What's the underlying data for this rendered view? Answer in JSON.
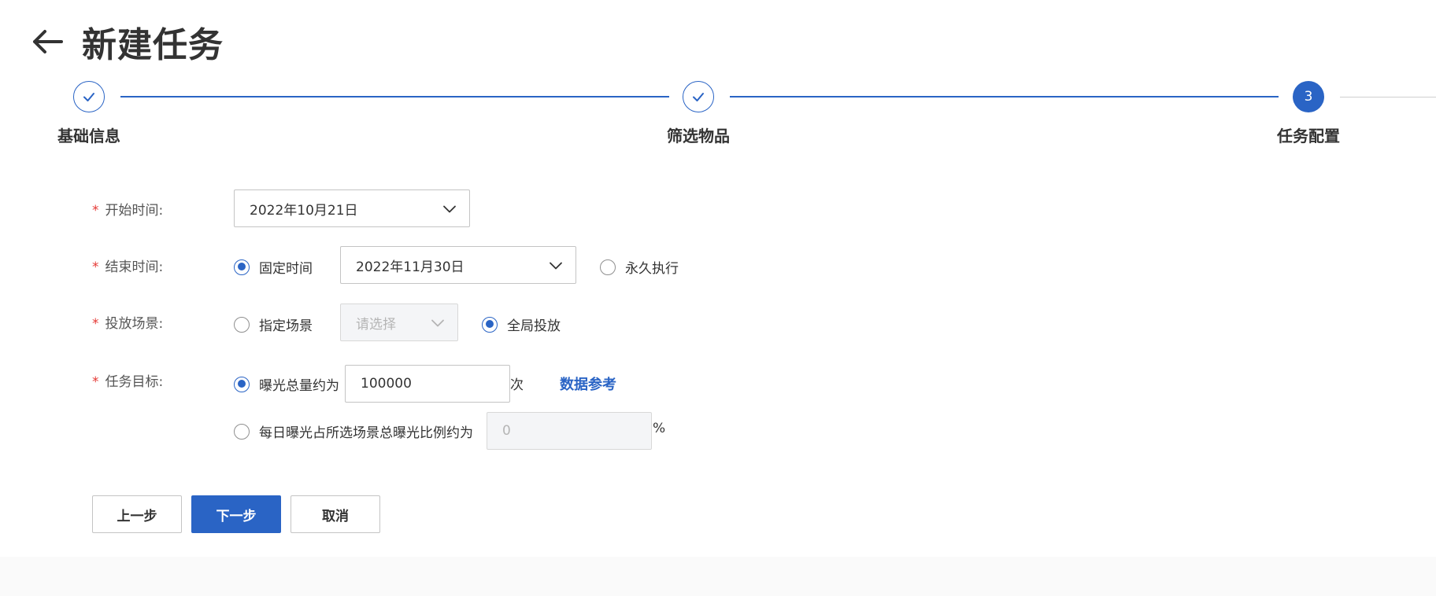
{
  "header": {
    "title": "新建任务"
  },
  "steps": [
    {
      "label": "基础信息",
      "status": "done"
    },
    {
      "label": "筛选物品",
      "status": "done"
    },
    {
      "label": "任务配置",
      "status": "active",
      "number": "3"
    }
  ],
  "form": {
    "required_mark": "*",
    "start_time": {
      "label": "开始时间:",
      "value": "2022年10月21日"
    },
    "end_time": {
      "label": "结束时间:",
      "fixed_label": "固定时间",
      "fixed_checked": true,
      "value": "2022年11月30日",
      "forever_label": "永久执行",
      "forever_checked": false
    },
    "scene": {
      "label": "投放场景:",
      "specific_label": "指定场景",
      "specific_checked": false,
      "placeholder": "请选择",
      "global_label": "全局投放",
      "global_checked": true
    },
    "target": {
      "label": "任务目标:",
      "total_label": "曝光总量约为",
      "total_checked": true,
      "total_value": "100000",
      "total_unit": "次",
      "data_ref_link": "数据参考",
      "ratio_label": "每日曝光占所选场景总曝光比例约为",
      "ratio_checked": false,
      "ratio_placeholder": "0",
      "ratio_unit": "%"
    }
  },
  "buttons": {
    "prev": "上一步",
    "next": "下一步",
    "cancel": "取消"
  },
  "colors": {
    "primary": "#2a64c5",
    "required": "#e53935"
  }
}
